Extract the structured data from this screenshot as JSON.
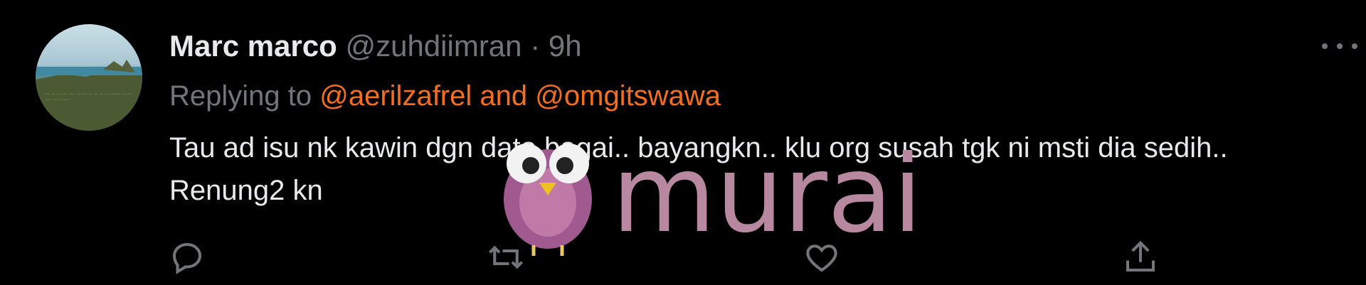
{
  "tweet": {
    "author": {
      "name": "Marc marco",
      "handle": "@zuhdiimran",
      "separator": "·",
      "time": "9h"
    },
    "reply": {
      "prefix": "Replying to",
      "mention1": "@aerilzafrel",
      "joiner": "and",
      "mention2": "@omgitswawa"
    },
    "text": "Tau ad isu nk kawin dgn dato bagai.. bayangkn.. klu org susah tgk ni msti dia sedih.. Renung2 kn"
  },
  "icons": [
    "more-icon",
    "reply-icon",
    "retweet-icon",
    "like-icon",
    "share-icon"
  ],
  "watermark": {
    "text": "murai"
  },
  "colors": {
    "background": "#000000",
    "text": "#e7e9ea",
    "muted": "#71767b",
    "mention": "#f46e1e",
    "watermark": "#b888a0"
  }
}
